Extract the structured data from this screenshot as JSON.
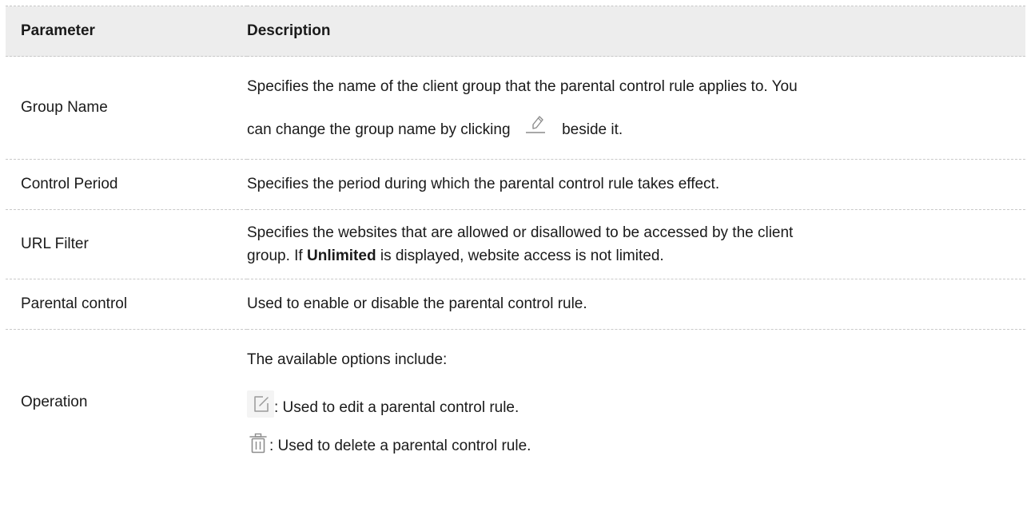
{
  "table": {
    "headers": {
      "parameter": "Parameter",
      "description": "Description"
    },
    "rows": {
      "group_name": {
        "parameter": "Group Name",
        "desc_line1": "Specifies the name of the client group that the parental control rule applies to. You",
        "desc_line2_before": "can change the group name by clicking",
        "desc_line2_after": "beside it.",
        "icon": "pencil-icon"
      },
      "control_period": {
        "parameter": "Control Period",
        "description": "Specifies the period during which the parental control rule takes effect."
      },
      "url_filter": {
        "parameter": "URL Filter",
        "desc_line1": "Specifies the websites that are allowed or disallowed to be accessed by the client",
        "desc_line2_before": "group. If",
        "desc_line2_bold": "Unlimited",
        "desc_line2_after": "is displayed, website access is not limited."
      },
      "parental_control": {
        "parameter": "Parental control",
        "description": "Used to enable or disable the parental control rule."
      },
      "operation": {
        "parameter": "Operation",
        "intro": "The available options include:",
        "edit_text": ": Used to edit a parental control rule.",
        "delete_text": ": Used to delete a parental control rule.",
        "edit_icon": "edit-icon",
        "delete_icon": "trash-icon"
      }
    }
  },
  "colors": {
    "header_bg": "#ededed",
    "divider": "#c9c9c9",
    "icon_gray": "#9a9a9a"
  }
}
